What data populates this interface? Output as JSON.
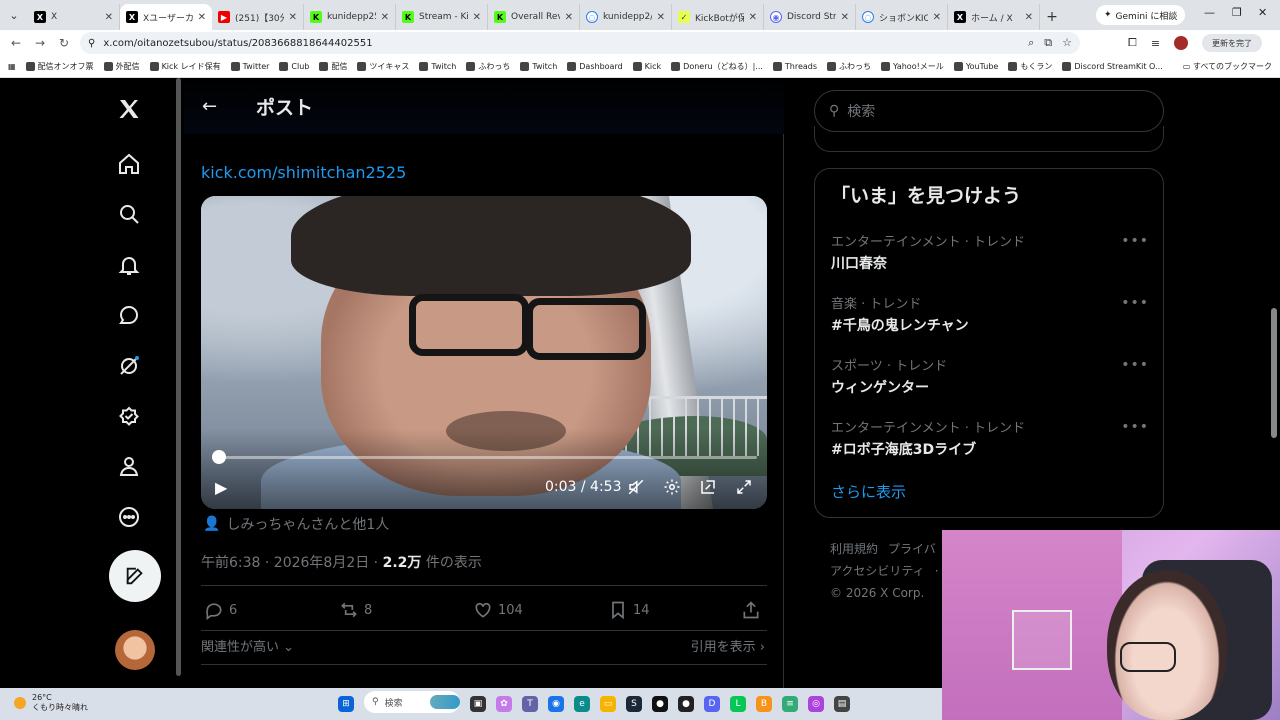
{
  "browser": {
    "tabs": [
      {
        "title": "X",
        "icon": "x-logo-icon"
      },
      {
        "title": "Xユーザーカツ",
        "icon": "x-logo-icon",
        "active": true
      },
      {
        "title": "(251)【30分】",
        "icon": "youtube-icon"
      },
      {
        "title": "kunidepp25",
        "icon": "kick-icon"
      },
      {
        "title": "Stream - Kic",
        "icon": "kick-icon"
      },
      {
        "title": "Overall Reve",
        "icon": "kick-icon"
      },
      {
        "title": "kunidepp2/",
        "icon": "globe-icon"
      },
      {
        "title": "KickBotが保",
        "icon": "bot-icon"
      },
      {
        "title": "Discord Stre",
        "icon": "discord-icon"
      },
      {
        "title": "ショボンKICK",
        "icon": "globe-icon"
      },
      {
        "title": "ホーム / X",
        "icon": "x-logo-icon"
      }
    ],
    "gemini_label": "Gemini に相談",
    "url": "x.com/oitanozetsubou/status/2083668818644402551",
    "update_label": "更新を完了",
    "bookmarks": [
      "配信オンオフ票",
      "外配信",
      "Kick レイド保有",
      "Twitter",
      "Club",
      "配信",
      "ツイキャス",
      "Twitch",
      "ふわっち",
      "Twitch",
      "Dashboard",
      "Kick",
      "Doneru（どねる）|...",
      "Threads",
      "ふわっち",
      "Yahoo!メール",
      "YouTube",
      "もくラン",
      "Discord StreamKit O..."
    ],
    "bookmarks_all": "すべてのブックマーク"
  },
  "page": {
    "header_title": "ポスト",
    "link_text": "kick.com/shimitchan2525",
    "video": {
      "current_time": "0:03",
      "total_time": "4:53",
      "timecode": "0:03 / 4:53",
      "progress": 0.011
    },
    "tagged_text": "しみっちゃんさんと他1人",
    "timestamp": "午前6:38 · 2026年8月2日 · ",
    "views_count": "2.2万",
    "views_label": " 件の表示",
    "actions": {
      "replies": "6",
      "reposts": "8",
      "likes": "104",
      "bookmarks": "14"
    },
    "relevance_label": "関連性が高い",
    "quotes_label": "引用を表示"
  },
  "sidebar": {
    "search_placeholder": "検索",
    "trends_title": "「いま」を見つけよう",
    "trends": [
      {
        "category": "エンターテインメント · トレンド",
        "name": "川口春奈"
      },
      {
        "category": "音楽 · トレンド",
        "name": "#千鳥の鬼レンチャン"
      },
      {
        "category": "スポーツ · トレンド",
        "name": "ウィンゲンター"
      },
      {
        "category": "エンターテインメント · トレンド",
        "name": "#ロボ子海底3Dライブ"
      }
    ],
    "show_more": "さらに表示",
    "footer": [
      "利用規約",
      "プライバ",
      "アクセシビリティ",
      "© 2026 X Corp."
    ]
  },
  "taskbar": {
    "temperature": "26°C",
    "weather": "くもり時々晴れ",
    "search_label": "検索"
  },
  "colors": {
    "accent": "#1d9bf0",
    "background": "#000000",
    "text": "#e7e9ea",
    "muted": "#71767b"
  }
}
